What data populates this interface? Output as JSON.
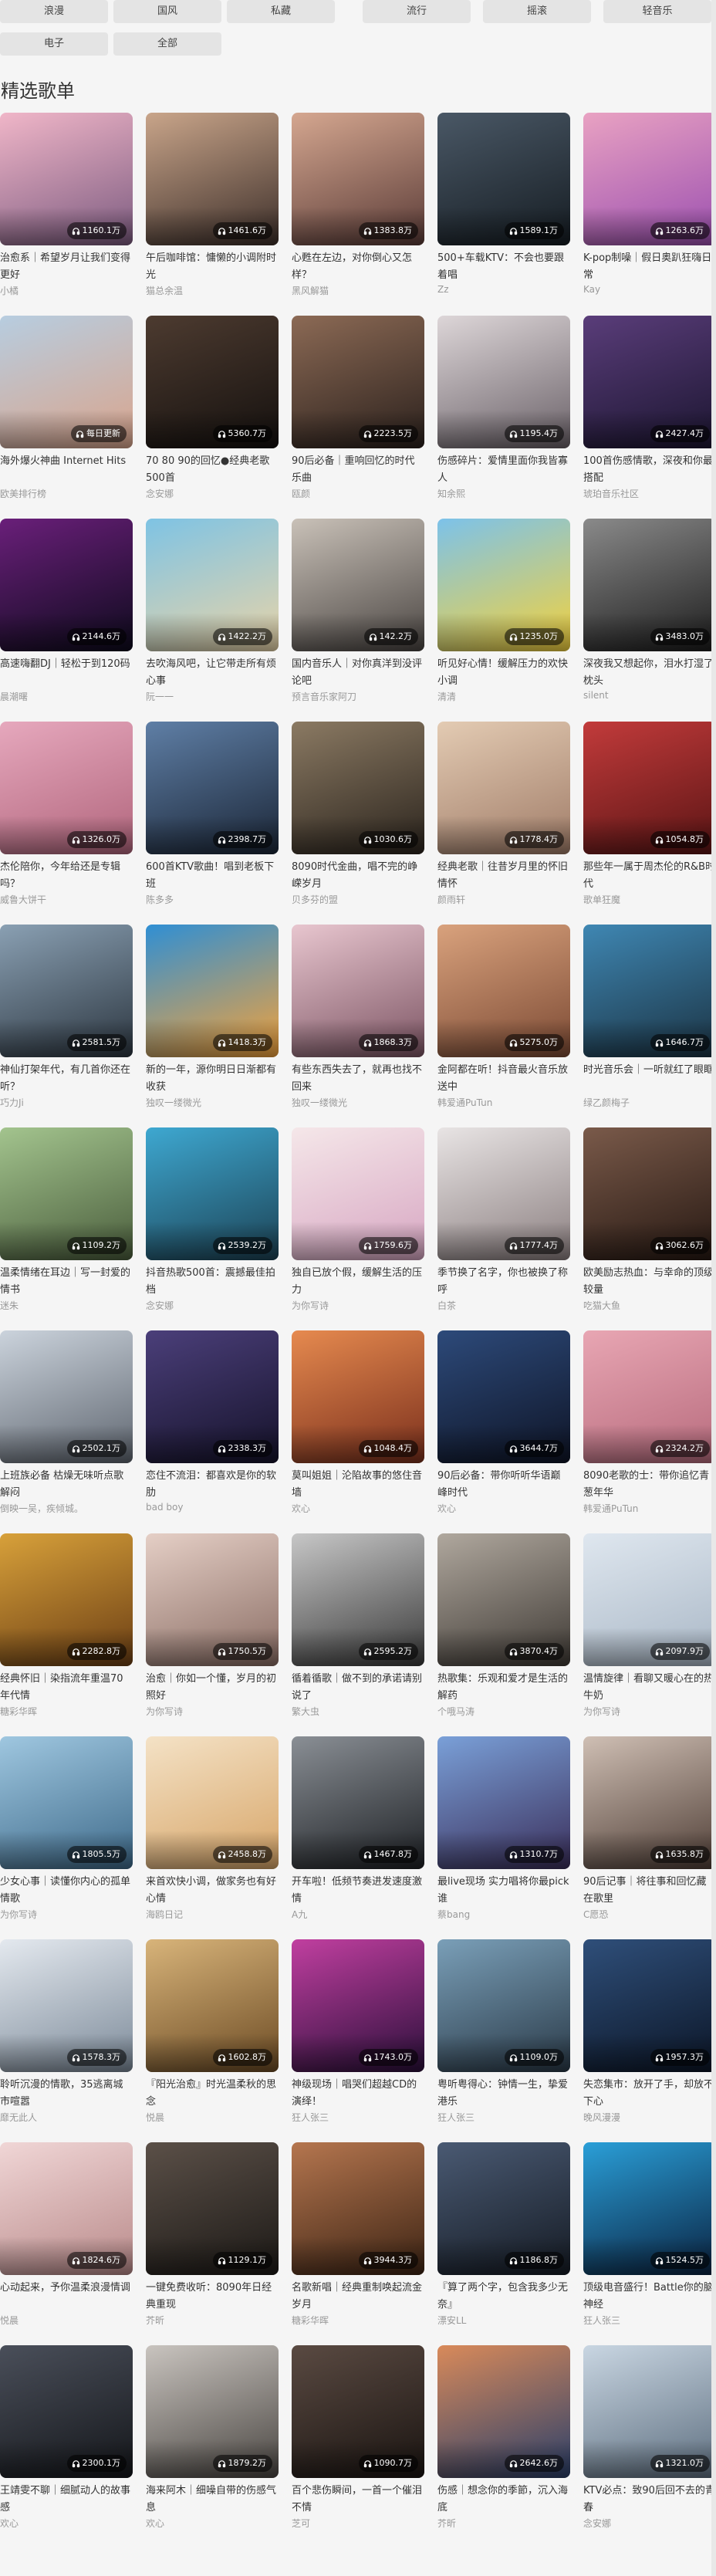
{
  "tabs": [
    {
      "label": "浪漫"
    },
    {
      "label": "国风"
    },
    {
      "label": "私藏"
    },
    {
      "label": "流行"
    },
    {
      "label": "摇滚"
    },
    {
      "label": "轻音乐"
    },
    {
      "label": "电子"
    },
    {
      "label": "全部"
    }
  ],
  "section_title": "精选歌单",
  "playlists": [
    {
      "title": "治愈系｜希望岁月让我们变得更好",
      "creator": "小橘",
      "plays": "1160.1万",
      "bg": [
        "#f0b6c8",
        "#7c5b80"
      ]
    },
    {
      "title": "午后咖啡馆：慵懒的小调附时光",
      "creator": "猫总余温",
      "plays": "1461.6万",
      "bg": [
        "#c9a58a",
        "#3d2f2a"
      ]
    },
    {
      "title": "心甦在左边，对你倒心又怎样？",
      "creator": "黑风解猫",
      "plays": "1383.8万",
      "bg": [
        "#d5a790",
        "#5a3b37"
      ]
    },
    {
      "title": "500+车载KTV：不会也要跟着唱",
      "creator": "Zz",
      "plays": "1589.1万",
      "bg": [
        "#4a5866",
        "#151c22"
      ]
    },
    {
      "title": "K-pop制噪｜假日奥趴狂嗨日常",
      "creator": "Kay",
      "plays": "1263.6万",
      "bg": [
        "#e9a2c2",
        "#9b4fb0"
      ]
    },
    {
      "title": "海外爆火神曲 Internet Hits",
      "creator": "欧美排行榜",
      "plays": "每日更新",
      "bg": [
        "#b7cde0",
        "#d9a48c"
      ]
    },
    {
      "title": "70 80 90的回忆●经典老歌500首",
      "creator": "念安娜",
      "plays": "5360.7万",
      "bg": [
        "#4d3b30",
        "#14100e"
      ]
    },
    {
      "title": "90后必备｜重响回忆的时代乐曲",
      "creator": "瓯颜",
      "plays": "2223.5万",
      "bg": [
        "#8c6a55",
        "#2a201c"
      ]
    },
    {
      "title": "伤感碎片：爱情里面你我皆寡人",
      "creator": "知余熙",
      "plays": "1195.4万",
      "bg": [
        "#ddd6d8",
        "#6a6168"
      ]
    },
    {
      "title": "100首伤感情歌，深夜和你最搭配",
      "creator": "琥珀音乐社区",
      "plays": "2427.4万",
      "bg": [
        "#5a3d7a",
        "#1b1530"
      ]
    },
    {
      "title": "高速嗨翻DJ｜轻松于到120码",
      "creator": "晨潮曙",
      "plays": "2144.6万",
      "bg": [
        "#6a1f7a",
        "#0d0a1c"
      ]
    },
    {
      "title": "去吹海风吧，让它带走所有烦心事",
      "creator": "阮一一",
      "plays": "1422.2万",
      "bg": [
        "#7ec3e4",
        "#e9d4a8"
      ]
    },
    {
      "title": "国内音乐人｜对你真洋到没评论吧",
      "creator": "预言音乐家阿刀",
      "plays": "142.2万",
      "bg": [
        "#c9c1b8",
        "#4a4542"
      ]
    },
    {
      "title": "听见好心情！缓解压力的欢快小调",
      "creator": "清清",
      "plays": "1235.0万",
      "bg": [
        "#7cc2ea",
        "#f4d23c"
      ]
    },
    {
      "title": "深夜我又想起你，泪水打湿了枕头",
      "creator": "silent",
      "plays": "3483.0万",
      "bg": [
        "#8a8a8a",
        "#1c1c1c"
      ]
    },
    {
      "title": "杰伦陪你，今年给还是专辑吗？",
      "creator": "威鲁大饼干",
      "plays": "1326.0万",
      "bg": [
        "#e6a8bd",
        "#b1657c"
      ]
    },
    {
      "title": "600首KTV歌曲！唱到老板下班",
      "creator": "陈多多",
      "plays": "2398.7万",
      "bg": [
        "#5f7fa6",
        "#1b2637"
      ]
    },
    {
      "title": "8090时代金曲，唱不完的峥嵘岁月",
      "creator": "贝多芬的盟",
      "plays": "1030.6万",
      "bg": [
        "#8b7a63",
        "#2b241d"
      ]
    },
    {
      "title": "经典老歌｜往昔岁月里的怀旧情怀",
      "creator": "颜雨轩",
      "plays": "1778.4万",
      "bg": [
        "#e3cbb3",
        "#a07c68"
      ]
    },
    {
      "title": "那些年一属于周杰伦的R&B时代",
      "creator": "歌单狂魔",
      "plays": "1054.8万",
      "bg": [
        "#c23b3b",
        "#5a1414"
      ]
    },
    {
      "title": "神仙打架年代，有几首你还在听？",
      "creator": "巧力Ji",
      "plays": "2581.5万",
      "bg": [
        "#8aa0b3",
        "#2c3640"
      ]
    },
    {
      "title": "新的一年，源你明日日渐都有收获",
      "creator": "独叹一缕微光",
      "plays": "1418.3万",
      "bg": [
        "#2f8fd4",
        "#f4a23a"
      ]
    },
    {
      "title": "有些东西失去了，就再也找不回来",
      "creator": "独叹一缕微光",
      "plays": "1868.3万",
      "bg": [
        "#e8c6cf",
        "#7d5564"
      ]
    },
    {
      "title": "金阿都在听！抖音最火音乐放送中",
      "creator": "韩爱通PuTun",
      "plays": "5275.0万",
      "bg": [
        "#d9a27d",
        "#7c4a34"
      ]
    },
    {
      "title": "时光音乐会｜一听就红了眼眶",
      "creator": "绿乙颜梅子",
      "plays": "1646.7万",
      "bg": [
        "#3f87b3",
        "#1b3343"
      ]
    },
    {
      "title": "温柔情绪在耳边｜写一封爱的情书",
      "creator": "迷朱",
      "plays": "1109.2万",
      "bg": [
        "#a3c48e",
        "#4a5d3c"
      ]
    },
    {
      "title": "抖音热歌500首：震撼最佳拍档",
      "creator": "念安娜",
      "plays": "2539.2万",
      "bg": [
        "#3ea8d1",
        "#1c4254"
      ]
    },
    {
      "title": "独自已放个假，缓解生活的压力",
      "creator": "为你写诗",
      "plays": "1759.6万",
      "bg": [
        "#f5e7e9",
        "#d7a6c2"
      ]
    },
    {
      "title": "季节换了名字，你也被换了称呼",
      "creator": "白茶",
      "plays": "1777.4万",
      "bg": [
        "#e8e4e4",
        "#8b7f80"
      ]
    },
    {
      "title": "欧美励志热血：与幸命的顶级较量",
      "creator": "吃猫大鱼",
      "plays": "3062.6万",
      "bg": [
        "#7a5a4a",
        "#261812"
      ]
    },
    {
      "title": "上班族必备 枯燥无味听点歌解闷",
      "creator": "倒映一吴，疾倾城。",
      "plays": "2502.1万",
      "bg": [
        "#cbd3dc",
        "#5f6670"
      ]
    },
    {
      "title": "恋住不流泪：都喜欢是你的软肋",
      "creator": "bad boy",
      "plays": "2338.3万",
      "bg": [
        "#4b3f7a",
        "#15122a"
      ]
    },
    {
      "title": "莫叫姐姐｜沦陷故事的悠住音墙",
      "creator": "欢心",
      "plays": "1048.4万",
      "bg": [
        "#e68a4f",
        "#7a2f1c"
      ]
    },
    {
      "title": "90后必备：带你听听华语巅峰时代",
      "creator": "欢心",
      "plays": "3644.7万",
      "bg": [
        "#2d4a7a",
        "#0e1426"
      ]
    },
    {
      "title": "8090老歌的士：带你追忆青葱年华",
      "creator": "韩爱通PuTun",
      "plays": "2324.2万",
      "bg": [
        "#e8a6b3",
        "#b76b7d"
      ]
    },
    {
      "title": "经典怀旧｜染指流年重温70年代情",
      "creator": "糖彩华晖",
      "plays": "2282.8万",
      "bg": [
        "#d8a13a",
        "#6b3e14"
      ]
    },
    {
      "title": "治愈｜你如一个懂，岁月的初照好",
      "creator": "为你写诗",
      "plays": "1750.5万",
      "bg": [
        "#e5cfc6",
        "#8a6d64"
      ]
    },
    {
      "title": "循着循歌｜做不到的承诺请别说了",
      "creator": "繁大虫",
      "plays": "2595.2万",
      "bg": [
        "#c7c7c7",
        "#3a3a3a"
      ]
    },
    {
      "title": "热歌集：乐观和爱才是生活的解药",
      "creator": "个哦马涛",
      "plays": "3870.4万",
      "bg": [
        "#b0a89e",
        "#3f3a35"
      ]
    },
    {
      "title": "温情旋律｜看聊又暖心在的热牛奶",
      "creator": "为你写诗",
      "plays": "2097.9万",
      "bg": [
        "#dfe7ef",
        "#a9b7c6"
      ]
    },
    {
      "title": "少女心事｜读懂你内心的孤单情歌",
      "creator": "为你写诗",
      "plays": "1805.5万",
      "bg": [
        "#9fc7e0",
        "#3e6a8a"
      ]
    },
    {
      "title": "来首欢快小调，做家务也有好心情",
      "creator": "海鸥日记",
      "plays": "2458.8万",
      "bg": [
        "#f4e2c6",
        "#d7a568"
      ]
    },
    {
      "title": "开车啦！低频节奏进发速度激情",
      "creator": "A九",
      "plays": "1467.8万",
      "bg": [
        "#8a8f95",
        "#1d2024"
      ]
    },
    {
      "title": "最live现场 实力唱将你最pick谁",
      "creator": "蔡bang",
      "plays": "1310.7万",
      "bg": [
        "#7aa0d8",
        "#3a2e5a"
      ]
    },
    {
      "title": "90后记事｜将往事和回忆藏在歌里",
      "creator": "C愿恐",
      "plays": "1635.8万",
      "bg": [
        "#cfbfb4",
        "#4f3e36"
      ]
    },
    {
      "title": "聆听沉漫的情歌，35逃离城市喧嚣",
      "creator": "靡无此人",
      "plays": "1578.3万",
      "bg": [
        "#e4e9ef",
        "#7c8a99"
      ]
    },
    {
      "title": "『阳光治愈』时光温柔秋的思念",
      "creator": "悦晨",
      "plays": "1602.8万",
      "bg": [
        "#d8b47a",
        "#6c4b24"
      ]
    },
    {
      "title": "神级现场｜唱哭们超越CD的演绎！",
      "creator": "狂人张三",
      "plays": "1743.0万",
      "bg": [
        "#c13fa0",
        "#2a0f3a"
      ]
    },
    {
      "title": "粤听粤得心：钟情一生，挚爱港乐",
      "creator": "狂人张三",
      "plays": "1109.0万",
      "bg": [
        "#7a9fb8",
        "#2a3a48"
      ]
    },
    {
      "title": "失恋集市：放开了手，却放不下心",
      "creator": "晚风漫漫",
      "plays": "1957.3万",
      "bg": [
        "#2f4f7a",
        "#0b1526"
      ]
    },
    {
      "title": "心动起来，予你温柔浪漫情调",
      "creator": "悦晨",
      "plays": "1824.6万",
      "bg": [
        "#f0d6d6",
        "#b98a8a"
      ]
    },
    {
      "title": "一键免费收听：8090年日经典重现",
      "creator": "芥昕",
      "plays": "1129.1万",
      "bg": [
        "#5b5048",
        "#1c1916"
      ]
    },
    {
      "title": "名歌新唱｜经典重制唤起流金岁月",
      "creator": "糖彩华晖",
      "plays": "3944.3万",
      "bg": [
        "#b5764f",
        "#3d2414"
      ]
    },
    {
      "title": "『算了两个字，包含我多少无奈』",
      "creator": "漂安LL",
      "plays": "1186.8万",
      "bg": [
        "#4a5a73",
        "#151b24"
      ]
    },
    {
      "title": "顶级电音盛行！Battle你的脑神经",
      "creator": "狂人张三",
      "plays": "1524.5万",
      "bg": [
        "#2a9fd8",
        "#0a2240"
      ]
    },
    {
      "title": "王靖雯不聊｜细腻动人的故事感",
      "creator": "欢心",
      "plays": "2300.1万",
      "bg": [
        "#4a4f5a",
        "#14161a"
      ]
    },
    {
      "title": "海来阿木｜细噪自带的伤感气息",
      "creator": "欢心",
      "plays": "1879.2万",
      "bg": [
        "#c9c4bf",
        "#4a4642"
      ]
    },
    {
      "title": "百个悲伤瞬间，一首一个催泪不情",
      "creator": "芝可",
      "plays": "1090.7万",
      "bg": [
        "#5a4a42",
        "#1a1411"
      ]
    },
    {
      "title": "伤感｜想念你的季節，沉入海底",
      "creator": "芥昕",
      "plays": "2642.6万",
      "bg": [
        "#d98a5a",
        "#2a3f6a"
      ]
    },
    {
      "title": "KTV必点：致90后回不去的青春",
      "creator": "念安娜",
      "plays": "1321.0万",
      "bg": [
        "#c9d6e2",
        "#5e6f80"
      ]
    }
  ]
}
